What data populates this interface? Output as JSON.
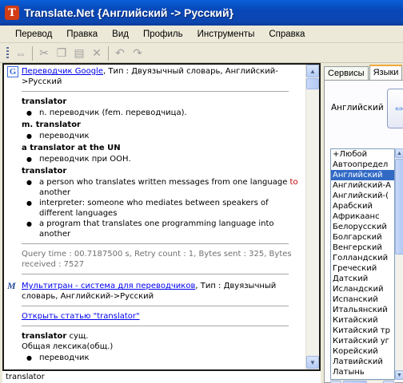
{
  "window": {
    "title": "Translate.Net  {Английский -> Русский}",
    "app_icon_letter": "T"
  },
  "menu": [
    {
      "label": "Перевод"
    },
    {
      "label": "Правка"
    },
    {
      "label": "Вид"
    },
    {
      "label": "Профиль"
    },
    {
      "label": "Инструменты"
    },
    {
      "label": "Справка"
    }
  ],
  "toolbar": [
    "translate-icon",
    "cut-icon",
    "copy-icon",
    "paste-icon",
    "delete-icon",
    "undo-icon",
    "redo-icon"
  ],
  "results": {
    "google": {
      "logo_letter": "G",
      "service_link": "Переводчик Google",
      "service_info": ", Тип : Двуязычный словарь, Английский->Русский",
      "entries": [
        {
          "term": "translator",
          "defs": [
            "n. переводчик (fem. переводчица)."
          ]
        },
        {
          "term": "m. translator",
          "defs": [
            "переводчик"
          ]
        },
        {
          "term": "a translator at the UN",
          "defs": [
            "переводчик при ООН."
          ]
        }
      ],
      "translator_en": {
        "term": "translator",
        "def1_before": "a person who translates written messages from one language ",
        "def1_red": "to",
        "def1_after": " another",
        "def2": "interpreter: someone who mediates between speakers of different languages",
        "def3": "a program that translates one programming language into another"
      },
      "stats": "Query time : 00.7187500 s, Retry count : 1, Bytes sent : 325, Bytes received : 7527"
    },
    "multitran": {
      "logo_letter": "M",
      "service_link": "Мультитран - система для переводчиков",
      "service_info": ", Тип : Двуязычный словарь, Английский->Русский",
      "open_article_link": "Открыть статью \"translator\"",
      "term": "translator",
      "pos": " сущ.",
      "category": "Общая лексика(общ.)",
      "defs": [
        "переводчик"
      ]
    }
  },
  "input": {
    "value": "translator"
  },
  "right_pane": {
    "tabs": [
      "Сервисы",
      "Языки"
    ],
    "active_tab": "Языки",
    "from_language": "Английский",
    "languages": [
      "+Любой",
      "Автоопредел",
      "Английский",
      "Английский-А",
      "Английский-(",
      "Арабский",
      "Африкаанс",
      "Белорусский",
      "Болгарский",
      "Венгерский",
      "Голландский",
      "Греческий",
      "Датский",
      "Исландский",
      "Испанский",
      "Итальянский",
      "Китайский",
      "Китайский тр",
      "Китайский уг",
      "Корейский",
      "Латвийский",
      "Латынь"
    ],
    "selected_language": "Английский"
  }
}
